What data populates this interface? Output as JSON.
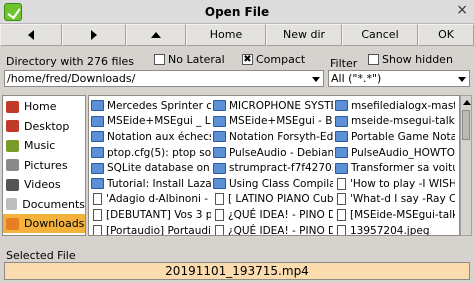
{
  "window": {
    "title": "Open File",
    "close_glyph": "×"
  },
  "toolbar": {
    "back_icon": "arrow-left-icon",
    "forward_icon": "arrow-right-icon",
    "up_icon": "arrow-up-icon",
    "home_label": "Home",
    "newdir_label": "New dir",
    "cancel_label": "Cancel",
    "ok_label": "OK"
  },
  "directory": {
    "info": "Directory with 276 files",
    "path": "/home/fred/Downloads/",
    "no_lateral_label": "No Lateral",
    "no_lateral_checked": false,
    "compact_label": "Compact",
    "compact_checked": true,
    "compact_mark": "✖"
  },
  "filter": {
    "label": "Filter",
    "value": "All (\"*.*\")",
    "show_hidden_label": "Show hidden",
    "show_hidden_checked": false
  },
  "places": [
    {
      "label": "Home",
      "icon": "home-icon",
      "color": "#c0392b",
      "selected": false
    },
    {
      "label": "Desktop",
      "icon": "desktop-icon",
      "color": "#c0392b",
      "selected": false
    },
    {
      "label": "Music",
      "icon": "music-icon",
      "color": "#7a9a2a",
      "selected": false
    },
    {
      "label": "Pictures",
      "icon": "pictures-icon",
      "color": "#8a8a8a",
      "selected": false
    },
    {
      "label": "Videos",
      "icon": "videos-icon",
      "color": "#555555",
      "selected": false
    },
    {
      "label": "Documents",
      "icon": "documents-icon",
      "color": "#bdbdbd",
      "selected": false
    },
    {
      "label": "Downloads",
      "icon": "downloads-icon",
      "color": "#e67e22",
      "selected": true
    }
  ],
  "files": {
    "columns": [
      [
        {
          "name": "Mercedes Sprinter con",
          "type": "folder"
        },
        {
          "name": "MSEide+MSEgui _ List",
          "type": "folder"
        },
        {
          "name": "Notation aux échecs —",
          "type": "folder"
        },
        {
          "name": "ptop.cfg(5): ptop source",
          "type": "folder"
        },
        {
          "name": "SQLite database on a se",
          "type": "folder"
        },
        {
          "name": "Tutorial: Install Lazarus",
          "type": "folder"
        },
        {
          "name": "'Adagio d-Albinoni - -La",
          "type": "file"
        },
        {
          "name": "[DEBUTANT] Vos 3 pre",
          "type": "file"
        },
        {
          "name": "[Portaudio] Portaudio F",
          "type": "file"
        },
        {
          "name": "20191101_193715.mp4",
          "type": "file",
          "selected": true
        }
      ],
      [
        {
          "name": "MICROPHONE SYSTEMS",
          "type": "folder"
        },
        {
          "name": "MSEide+MSEgui - Brow",
          "type": "folder"
        },
        {
          "name": "Notation Forsyth-Edwa",
          "type": "folder"
        },
        {
          "name": "PulseAudio - Debian Wi",
          "type": "folder"
        },
        {
          "name": "strumpract-f7f427037",
          "type": "folder"
        },
        {
          "name": "Using Class Compilation",
          "type": "folder"
        },
        {
          "name": "[ LATINO PIANO Cuban",
          "type": "file"
        },
        {
          "name": "¿QUÉ IDEA! - PINO D'AI",
          "type": "file"
        },
        {
          "name": "¿QUÉ IDEA! - PINO D'AI",
          "type": "file"
        },
        {
          "name": "20191101_200609.mp4",
          "type": "file"
        }
      ],
      [
        {
          "name": "msefiledialogx-master",
          "type": "folder"
        },
        {
          "name": "mseide-msegui-talk - ",
          "type": "folder"
        },
        {
          "name": "Portable Game Notation",
          "type": "folder"
        },
        {
          "name": "PulseAudio_HOWTO: D",
          "type": "folder"
        },
        {
          "name": "Transformer sa voiture",
          "type": "folder"
        },
        {
          "name": "'How to play -I WISH-",
          "type": "file"
        },
        {
          "name": "'What-d I say -Ray Cha",
          "type": "file"
        },
        {
          "name": "[MSEide-MSEgui-talk] (",
          "type": "file"
        },
        {
          "name": "13957204.jpeg",
          "type": "file"
        },
        {
          "name": "3 astuces de grand-mé",
          "type": "file"
        }
      ]
    ]
  },
  "selected_file": {
    "label": "Selected File",
    "value": "20191101_193715.mp4"
  }
}
